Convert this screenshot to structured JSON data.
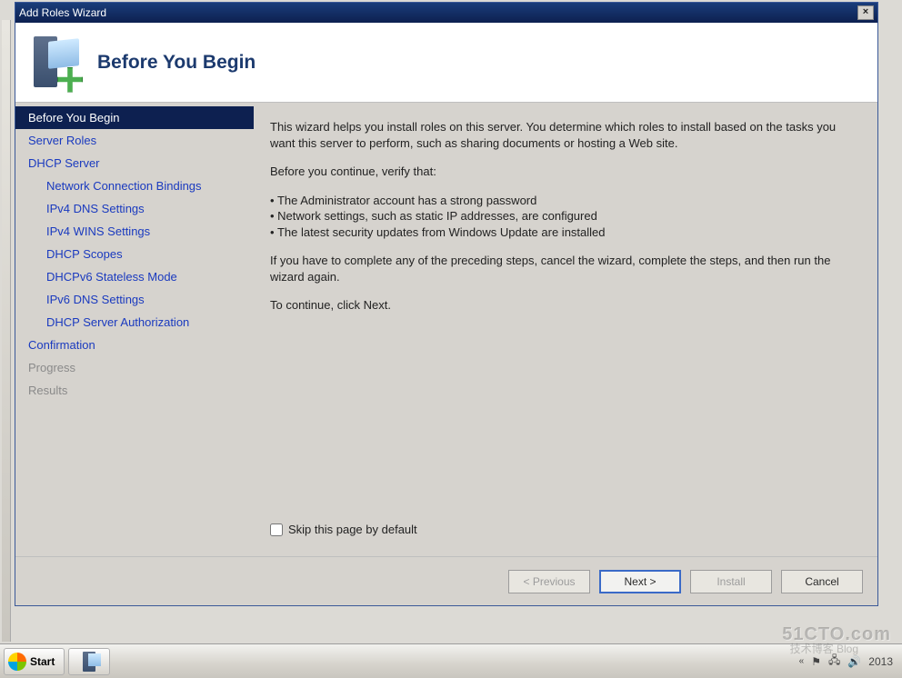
{
  "window": {
    "title": "Add Roles Wizard",
    "close_icon": "×"
  },
  "header": {
    "page_title": "Before You Begin"
  },
  "sidebar": {
    "items": [
      {
        "label": "Before You Begin",
        "selected": true
      },
      {
        "label": "Server Roles"
      },
      {
        "label": "DHCP Server"
      },
      {
        "label": "Network Connection Bindings",
        "sub": true
      },
      {
        "label": "IPv4 DNS Settings",
        "sub": true
      },
      {
        "label": "IPv4 WINS Settings",
        "sub": true
      },
      {
        "label": "DHCP Scopes",
        "sub": true
      },
      {
        "label": "DHCPv6 Stateless Mode",
        "sub": true
      },
      {
        "label": "IPv6 DNS Settings",
        "sub": true
      },
      {
        "label": "DHCP Server Authorization",
        "sub": true
      },
      {
        "label": "Confirmation"
      },
      {
        "label": "Progress",
        "disabled": true
      },
      {
        "label": "Results",
        "disabled": true
      }
    ]
  },
  "content": {
    "intro": "This wizard helps you install roles on this server. You determine which roles to install based on the tasks you want this server to perform, such as sharing documents or hosting a Web site.",
    "verify_heading": "Before you continue, verify that:",
    "bullets": [
      "The Administrator account has a strong password",
      "Network settings, such as static IP addresses, are configured",
      "The latest security updates from Windows Update are installed"
    ],
    "cancel_hint": "If you have to complete any of the preceding steps, cancel the wizard, complete the steps, and then run the wizard again.",
    "continue_hint": "To continue, click Next.",
    "skip_label": "Skip this page by default"
  },
  "footer": {
    "previous": "< Previous",
    "next": "Next >",
    "install": "Install",
    "cancel": "Cancel"
  },
  "taskbar": {
    "start": "Start",
    "year": "2013"
  },
  "watermark": {
    "main": "51CTO.com",
    "sub": "技术博客 Blog"
  }
}
